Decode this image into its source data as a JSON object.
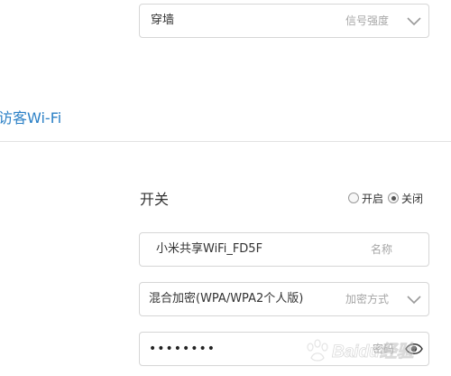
{
  "signal_field": {
    "value": "穿墙",
    "hint": "信号强度"
  },
  "guest_section": {
    "title": "访客Wi-Fi"
  },
  "switch": {
    "label": "开关",
    "options": [
      {
        "label": "开启",
        "checked": false
      },
      {
        "label": "关闭",
        "checked": true
      }
    ]
  },
  "name_field": {
    "value": "小米共享WiFi_FD5F",
    "hint": "名称"
  },
  "encryption_field": {
    "value": "混合加密(WPA/WPA2个人版)",
    "hint": "加密方式"
  },
  "password_field": {
    "value": "••••••••",
    "hint": "密码"
  },
  "watermark": {
    "text": "Baidu经验"
  },
  "colors": {
    "accent": "#2b80c6",
    "border": "#d6d6d6",
    "hint": "#a6a6a6",
    "text": "#333333"
  },
  "icons": {
    "dropdown": "chevron-down-icon",
    "password_toggle": "eye-icon"
  }
}
